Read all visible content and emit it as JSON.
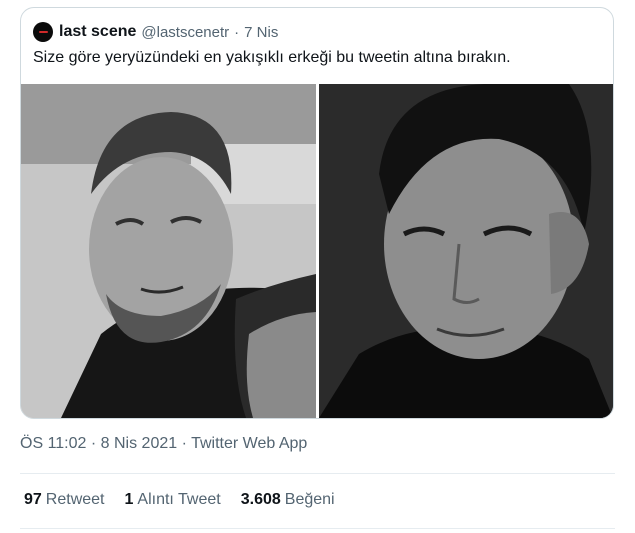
{
  "quoted_tweet": {
    "author_name": "last scene",
    "handle": "@lastscenetr",
    "separator": "·",
    "date": "7 Nis",
    "text": "Size göre yeryüzündeki en yakışıklı erkeği bu tweetin altına bırakın.",
    "media": [
      {
        "name": "photo-left",
        "icon": "bw-portrait-bearded-man"
      },
      {
        "name": "photo-right",
        "icon": "bw-portrait-dark-haired-man"
      }
    ]
  },
  "tweet_meta": {
    "time": "ÖS 11:02",
    "sep1": "·",
    "date": "8 Nis 2021",
    "sep2": "·",
    "source": "Twitter Web App"
  },
  "stats": {
    "retweets": {
      "count": "97",
      "label": "Retweet"
    },
    "quotes": {
      "count": "1",
      "label": "Alıntı Tweet"
    },
    "likes": {
      "count": "3.608",
      "label": "Beğeni"
    }
  },
  "colors": {
    "text": "#0f1419",
    "secondary": "#536471",
    "border": "#cfd9de"
  }
}
